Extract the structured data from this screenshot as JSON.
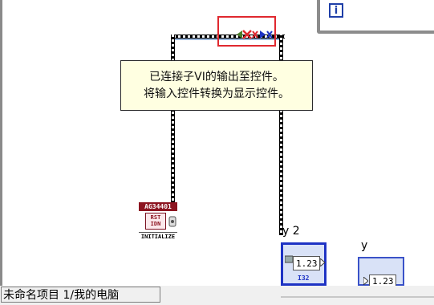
{
  "tooltip": {
    "line1": "已连接子VI的输出至控件。",
    "line2": "将输入控件转换为显示控件。"
  },
  "subvi": {
    "header": "AG34401",
    "card_lines": [
      "RST",
      "IDN"
    ],
    "footer": "INITIALIZE"
  },
  "indicators": [
    {
      "label": "y 2",
      "value": "1.23"
    },
    {
      "label": "y",
      "value": "1.23"
    }
  ],
  "structure": {
    "icon_text": "i"
  },
  "statusbar": {
    "text": "未命名项目 1/我的电脑"
  },
  "colors": {
    "error_highlight": "#e0282f",
    "indicator_border": "#1e33c4",
    "tooltip_bg": "#ffffe1",
    "subvi_header": "#8c1420"
  }
}
